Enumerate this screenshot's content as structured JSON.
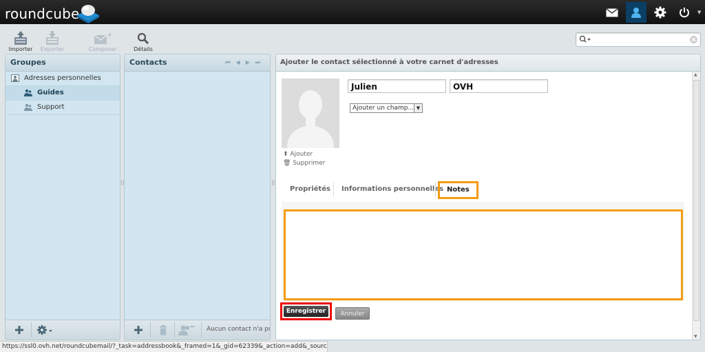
{
  "app": {
    "logo_text": "roundcube"
  },
  "topnav": [
    {
      "name": "mail-icon",
      "active": false
    },
    {
      "name": "contacts-icon",
      "active": true
    },
    {
      "name": "settings-icon",
      "active": false
    },
    {
      "name": "logout-icon",
      "active": false
    }
  ],
  "toolbar": {
    "import": "Importer",
    "export": "Exporter",
    "compose": "Composer",
    "details": "Détails"
  },
  "groups": {
    "title": "Groupes",
    "items": [
      {
        "label": "Adresses personnelles",
        "selected": false
      },
      {
        "label": "Guides",
        "selected": true
      },
      {
        "label": "Support",
        "selected": false
      }
    ]
  },
  "contacts": {
    "title": "Contacts",
    "footer_text": "Aucun contact n'a pu"
  },
  "content": {
    "title": "Ajouter le contact sélectionné à votre carnet d'adresses",
    "photo_add": "Ajouter",
    "photo_delete": "Supprimer",
    "firstname": "Julien",
    "lastname": "OVH",
    "add_field": "Ajouter un champ...",
    "tabs": {
      "properties": "Propriétés",
      "personal": "Informations personnelles",
      "notes": "Notes"
    },
    "save": "Enregistrer",
    "cancel": "Annuler"
  },
  "status_url": "https://ssl0.ovh.net/roundcubemail/?_task=addressbook&_framed=1&_gid=62339&_action=add&_source=0&_cid=0#",
  "colors": {
    "highlight_orange": "#f39c12",
    "highlight_red": "#e00000",
    "active_nav": "#0b3f66"
  }
}
